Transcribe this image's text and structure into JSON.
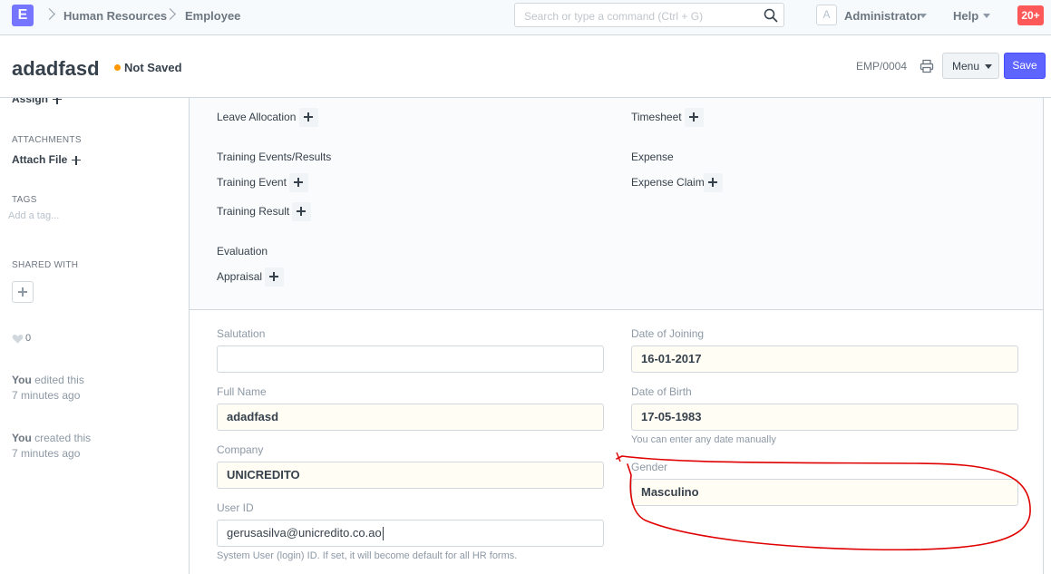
{
  "navbar": {
    "logo_letter": "E",
    "breadcrumbs": [
      "Human Resources",
      "Employee"
    ],
    "search_placeholder": "Search or type a command (Ctrl + G)",
    "avatar_letter": "A",
    "user_name": "Administrator",
    "help_label": "Help",
    "notification_count": "20+"
  },
  "page_head": {
    "title": "adadfasd",
    "status": "Not Saved",
    "doc_id": "EMP/0004",
    "menu_label": "Menu",
    "save_label": "Save"
  },
  "sidebar": {
    "assign_label": "Assign",
    "attachments_heading": "ATTACHMENTS",
    "attach_file_label": "Attach File",
    "tags_heading": "TAGS",
    "add_tag_placeholder": "Add a tag...",
    "shared_with_heading": "SHARED WITH",
    "like_count": "0",
    "activity": [
      {
        "who": "You",
        "action": " edited this",
        "when": "7 minutes ago"
      },
      {
        "who": "You",
        "action": " created this",
        "when": "7 minutes ago"
      }
    ]
  },
  "dashboard": {
    "left": {
      "leave_allocation": "Leave Allocation",
      "training_heading": "Training Events/Results",
      "training_event": "Training Event",
      "training_result": "Training Result",
      "evaluation_heading": "Evaluation",
      "appraisal": "Appraisal"
    },
    "right": {
      "timesheet": "Timesheet",
      "expense_heading": "Expense",
      "expense_claim": "Expense Claim"
    }
  },
  "form": {
    "salutation": {
      "label": "Salutation",
      "value": ""
    },
    "full_name": {
      "label": "Full Name",
      "value": "adadfasd"
    },
    "company": {
      "label": "Company",
      "value": "UNICREDITO"
    },
    "user_id": {
      "label": "User ID",
      "value": "gerusasilva@unicredito.co.ao",
      "help": "System User (login) ID. If set, it will become default for all HR forms."
    },
    "date_of_joining": {
      "label": "Date of Joining",
      "value": "16-01-2017"
    },
    "date_of_birth": {
      "label": "Date of Birth",
      "value": "17-05-1983",
      "help": "You can enter any date manually"
    },
    "gender": {
      "label": "Gender",
      "value": "Masculino"
    }
  },
  "colors": {
    "primary": "#5e64ff",
    "logo": "#7575ff",
    "notification": "#ff5858",
    "not_saved_dot": "#ff9800",
    "annotation": "#e00000"
  }
}
